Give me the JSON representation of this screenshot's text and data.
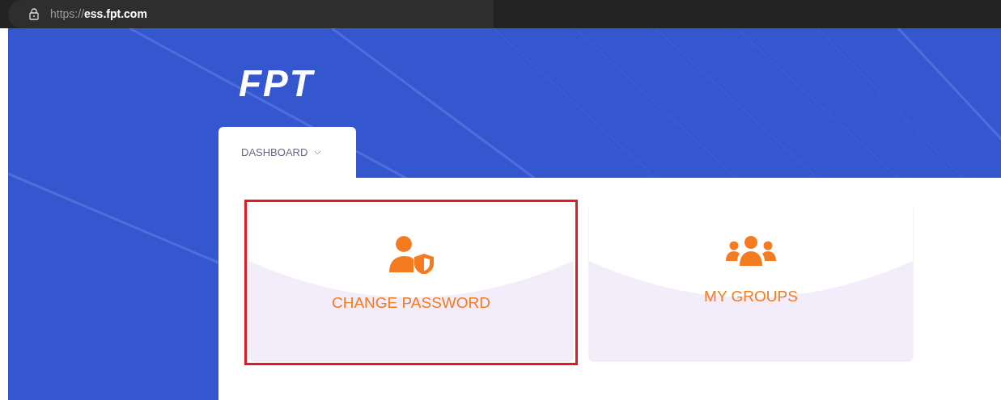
{
  "address_bar": {
    "scheme": "https://",
    "host": "ess.fpt.com"
  },
  "logo": {
    "text": "FPT"
  },
  "tabs": [
    {
      "label": "DASHBOARD",
      "selected": true
    }
  ],
  "cards": [
    {
      "kind": "password",
      "label": "CHANGE PASSWORD",
      "highlighted": true
    },
    {
      "kind": "groups",
      "label": "MY GROUPS",
      "highlighted": false
    }
  ]
}
